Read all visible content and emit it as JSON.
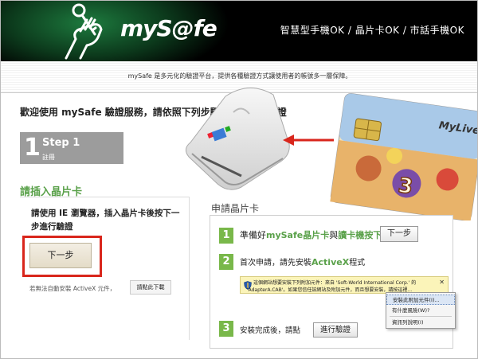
{
  "header": {
    "brand": "myS@fe",
    "tagline": "智慧型手機OK / 晶片卡OK / 市話手機OK"
  },
  "intro": {
    "text": "mySafe 是多元化的驗證平台，提供各種驗證方式讓使用者的帳號多一層保障。"
  },
  "welcome_heading": "歡迎使用 mySafe 驗證服務，請依照下列步驟申請晶片卡驗證",
  "step": {
    "number": "1",
    "title": "Step 1",
    "subtitle": "註冊"
  },
  "left_panel": {
    "title": "請插入晶片卡",
    "instruction": "請使用 IE 瀏覽器，插入晶片卡後按下一步進行驗證",
    "next_button_label": "下一步",
    "activex_note": "若無法自動安裝 ActiveX 元件，",
    "manual_download_label": "請點此下載"
  },
  "card_brand": "MyLive",
  "right_panel": {
    "title": "申請晶片卡",
    "step1": {
      "number": "1",
      "prefix": "準備好",
      "highlight1": "mySafe晶片卡",
      "middle": "與",
      "highlight2": "讀卡機按下",
      "button_label": "下一步"
    },
    "step2": {
      "number": "2",
      "prefix": "首次申請，請先安裝",
      "highlight": "ActiveX",
      "suffix": "程式"
    },
    "step3": {
      "number": "3",
      "text": "安裝完成後，請點",
      "button_label": "進行驗證"
    }
  },
  "ie_infobar": {
    "line1": "這個網站想要安裝下列附加元件：來自 'Soft-World International Corp.' 的",
    "line2": "'AdapterA.CAB'。如果您信任該網站及附加元件，而且想要安裝，請按這裡...",
    "close": "✕"
  },
  "ie_context_menu": {
    "items": [
      "安裝此附加元件(I)...",
      "有什麼風險(W)?",
      "資訊列說明(I)"
    ]
  },
  "colors": {
    "accent_green": "#5aa14a",
    "step_green": "#79b84a",
    "highlight_red": "#d9261c",
    "step_gray": "#9c9c9c"
  }
}
